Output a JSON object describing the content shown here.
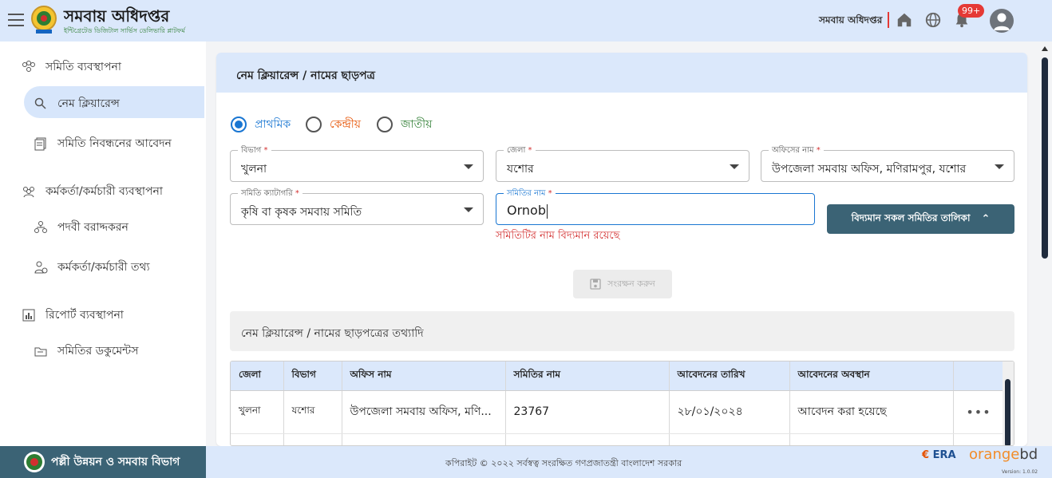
{
  "header": {
    "brand_title": "সমবায় অধিদপ্তর",
    "brand_subtitle": "ইন্টিগ্রেটেড ডিজিটাল সার্ভিস ডেলিভারি প্লাটফর্ম",
    "office_name": "সমবায় অধিদপ্তর",
    "notification_badge": "99+"
  },
  "sidebar": {
    "items": [
      {
        "label": "সমিতি ব্যবস্থাপনা"
      },
      {
        "label": "নেম ক্লিয়ারেন্স"
      },
      {
        "label": "সমিতি নিবন্ধনের আবেদন"
      },
      {
        "label": "কর্মকর্তা/কর্মচারী ব্যবস্থাপনা"
      },
      {
        "label": "পদবী বরাদ্দকরন"
      },
      {
        "label": "কর্মকর্তা/কর্মচারী তথ্য"
      },
      {
        "label": "রিপোর্ট ব্যবস্থাপনা"
      },
      {
        "label": "সমিতির ডকুমেন্টস"
      }
    ]
  },
  "page": {
    "title": "নেম ক্লিয়ারেন্স / নামের ছাড়পত্র",
    "radios": [
      {
        "label": "প্রাথমিক",
        "color": "#1976d2",
        "selected": true
      },
      {
        "label": "কেন্দ্রীয়",
        "color": "#e65100",
        "selected": false
      },
      {
        "label": "জাতীয়",
        "color": "#2e7d32",
        "selected": false
      }
    ],
    "fields": {
      "division": {
        "label": "বিভাগ",
        "value": "খুলনা"
      },
      "district": {
        "label": "জেলা",
        "value": "যশোর"
      },
      "office": {
        "label": "অফিসের নাম",
        "value": "উপজেলা সমবায় অফিস, মণিরামপুর, যশোর"
      },
      "category": {
        "label": "সমিতি ক্যাটাগরি",
        "value": "কৃষি বা কৃষক সমবায় সমিতি"
      },
      "samity_name": {
        "label": "সমিতির নাম",
        "value": "Ornob"
      }
    },
    "required_mark": "*",
    "error_text": "সমিতিটির নাম বিদ্যমান রয়েছে",
    "list_button": "বিদ্যমান সকল সমিতির তালিকা",
    "save_button": "সংরক্ষন করুন",
    "info_title": "নেম ক্লিয়ারেন্স / নামের ছাড়পত্রের তথ্যাদি",
    "table": {
      "headers": [
        "জেলা",
        "বিভাগ",
        "অফিস নাম",
        "সমিতির নাম",
        "আবেদনের তারিখ",
        "আবেদনের অবস্থান"
      ],
      "rows": [
        [
          "খুলনা",
          "যশোর",
          "উপজেলা সমবায় অফিস, মণি...",
          "23767",
          "২৮/০১/২০২৪",
          "আবেদন করা হয়েছে"
        ]
      ],
      "more": "•••"
    }
  },
  "footer": {
    "ministry": "পল্লী উন্নয়ন ও সমবায় বিভাগ",
    "copyright": "কপিরাইট © ২০২২ সর্বস্বত্ব সংরক্ষিত গণপ্রজাতন্ত্রী বাংলাদেশ সরকার",
    "era": "ERA",
    "orange_prefix": "orange",
    "orange_suffix": "bd",
    "version": "Version: 1.0.02"
  }
}
